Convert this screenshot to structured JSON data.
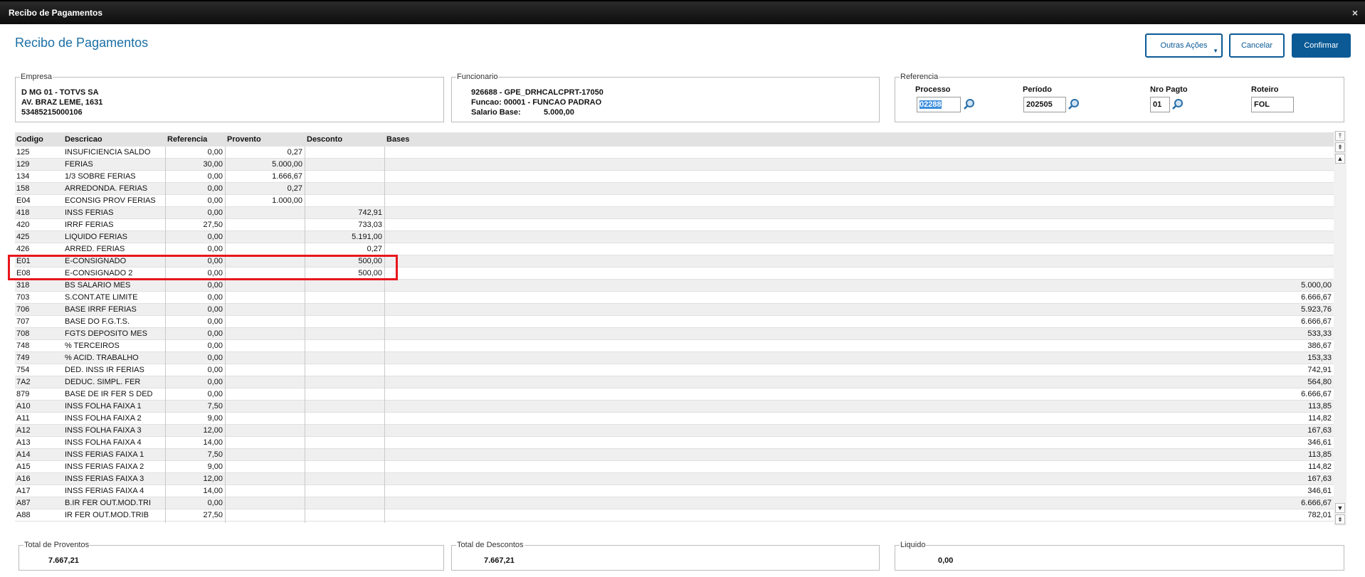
{
  "window": {
    "title": "Recibo de Pagamentos",
    "close_glyph": "×"
  },
  "heading": "Recibo de Pagamentos",
  "toolbar": {
    "outras_label": "Outras Ações",
    "cancelar_label": "Cancelar",
    "confirmar_label": "Confirmar"
  },
  "empresa": {
    "legend": "Empresa",
    "line1": "D MG 01  - TOTVS SA",
    "line2": "AV. BRAZ LEME, 1631",
    "line3": "53485215000106"
  },
  "funcionario": {
    "legend": "Funcionario",
    "line1": "926688 - GPE_DRHCALCPRT-17050",
    "line2": "Funcao: 00001 - FUNCAO PADRAO",
    "salario_label": "Salario Base:",
    "salario_value": "5.000,00"
  },
  "referencia": {
    "legend": "Referencia",
    "processo_label": "Processo",
    "processo_value": "02288",
    "periodo_label": "Período",
    "periodo_value": "202505",
    "nro_label": "Nro Pagto",
    "nro_value": "01",
    "roteiro_label": "Roteiro",
    "roteiro_value": "FOL"
  },
  "grid": {
    "columns": [
      "Codigo",
      "Descricao",
      "Referencia",
      "Provento",
      "Desconto",
      "Bases"
    ],
    "rows": [
      [
        "125",
        "INSUFICIENCIA SALDO",
        "0,00",
        "0,27",
        "",
        ""
      ],
      [
        "129",
        "FERIAS",
        "30,00",
        "5.000,00",
        "",
        ""
      ],
      [
        "134",
        "1/3 SOBRE FERIAS",
        "0,00",
        "1.666,67",
        "",
        ""
      ],
      [
        "158",
        "ARREDONDA. FERIAS",
        "0,00",
        "0,27",
        "",
        ""
      ],
      [
        "E04",
        "ECONSIG PROV FERIAS",
        "0,00",
        "1.000,00",
        "",
        ""
      ],
      [
        "418",
        "INSS FERIAS",
        "0,00",
        "",
        "742,91",
        ""
      ],
      [
        "420",
        "IRRF FERIAS",
        "27,50",
        "",
        "733,03",
        ""
      ],
      [
        "425",
        "LIQUIDO FERIAS",
        "0,00",
        "",
        "5.191,00",
        ""
      ],
      [
        "426",
        "ARRED. FERIAS",
        "0,00",
        "",
        "0,27",
        ""
      ],
      [
        "E01",
        "E-CONSIGNADO",
        "0,00",
        "",
        "500,00",
        ""
      ],
      [
        "E08",
        "E-CONSIGNADO 2",
        "0,00",
        "",
        "500,00",
        ""
      ],
      [
        "318",
        "BS SALARIO MES",
        "0,00",
        "",
        "",
        "5.000,00"
      ],
      [
        "703",
        "S.CONT.ATE LIMITE",
        "0,00",
        "",
        "",
        "6.666,67"
      ],
      [
        "706",
        "BASE IRRF FERIAS",
        "0,00",
        "",
        "",
        "5.923,76"
      ],
      [
        "707",
        "BASE DO F.G.T.S.",
        "0,00",
        "",
        "",
        "6.666,67"
      ],
      [
        "708",
        "FGTS DEPOSITO MES",
        "0,00",
        "",
        "",
        "533,33"
      ],
      [
        "748",
        "% TERCEIROS",
        "0,00",
        "",
        "",
        "386,67"
      ],
      [
        "749",
        "% ACID. TRABALHO",
        "0,00",
        "",
        "",
        "153,33"
      ],
      [
        "754",
        "DED. INSS IR FERIAS",
        "0,00",
        "",
        "",
        "742,91"
      ],
      [
        "7A2",
        "DEDUC. SIMPL. FER",
        "0,00",
        "",
        "",
        "564,80"
      ],
      [
        "879",
        "BASE DE IR FER S DED",
        "0,00",
        "",
        "",
        "6.666,67"
      ],
      [
        "A10",
        "INSS FOLHA FAIXA 1",
        "7,50",
        "",
        "",
        "113,85"
      ],
      [
        "A11",
        "INSS FOLHA FAIXA 2",
        "9,00",
        "",
        "",
        "114,82"
      ],
      [
        "A12",
        "INSS FOLHA FAIXA 3",
        "12,00",
        "",
        "",
        "167,63"
      ],
      [
        "A13",
        "INSS FOLHA FAIXA 4",
        "14,00",
        "",
        "",
        "346,61"
      ],
      [
        "A14",
        "INSS FERIAS FAIXA 1",
        "7,50",
        "",
        "",
        "113,85"
      ],
      [
        "A15",
        "INSS FERIAS FAIXA 2",
        "9,00",
        "",
        "",
        "114,82"
      ],
      [
        "A16",
        "INSS FERIAS FAIXA 3",
        "12,00",
        "",
        "",
        "167,63"
      ],
      [
        "A17",
        "INSS FERIAS FAIXA 4",
        "14,00",
        "",
        "",
        "346,61"
      ],
      [
        "A87",
        "B.IR FER OUT.MOD.TRI",
        "0,00",
        "",
        "",
        "6.666,67"
      ],
      [
        "A88",
        "IR FER OUT.MOD.TRIB",
        "27,50",
        "",
        "",
        "782,01"
      ]
    ]
  },
  "totals": {
    "proventos_label": "Total de Proventos",
    "proventos_value": "7.667,21",
    "descontos_label": "Total de Descontos",
    "descontos_value": "7.667,21",
    "liquido_label": "Liquido",
    "liquido_value": "0,00"
  },
  "colors": {
    "accent": "#0b5a95",
    "heading": "#1b6fa6",
    "highlight": "#e8161b"
  }
}
